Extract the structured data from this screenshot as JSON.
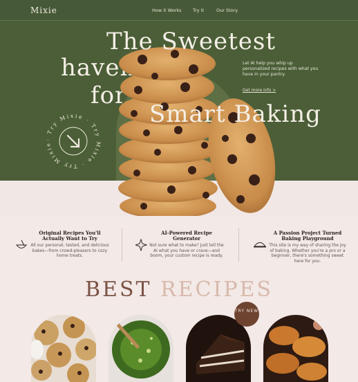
{
  "nav": {
    "logo": "Mixie",
    "links": [
      "How it Works",
      "Try It",
      "Our Story"
    ]
  },
  "hero": {
    "title_line1": "The Sweetest",
    "title_line2": "haven",
    "title_line3": "for",
    "title_line4": "Smart Baking",
    "copy": "Let AI help you whip up personalized recipes with what you have in your pantry.",
    "link": "Get more info >",
    "badge_text": "· Try Mixie · Try Mixie · Try Mixie "
  },
  "features": [
    {
      "title": "Original Recipes You'll Actually Want to Try",
      "text": "All our personal, tested, and delicious bakes—from crowd-pleasers to cozy home treats.",
      "icon": "mixing-bowl-icon"
    },
    {
      "title": "AI-Powered Recipe Generator",
      "text": "Not sure what to make? Just tell the AI what you have or crave—and boom, your custom recipe is ready.",
      "icon": "sparkle-icon"
    },
    {
      "title": "A Passion Project Turned Baking Playground",
      "text": "This site is my way of sharing the joy of baking. Whether you're a pro or a beginner, there's something sweet here for you.",
      "icon": "cloche-icon"
    }
  ],
  "best_recipes": {
    "word1": "BEST",
    "word2": "RECIPES",
    "badge": "TRY NEW"
  },
  "colors": {
    "hero_green": "#4b5e37",
    "brown": "#7a5244",
    "blush": "#d7b9ab"
  }
}
